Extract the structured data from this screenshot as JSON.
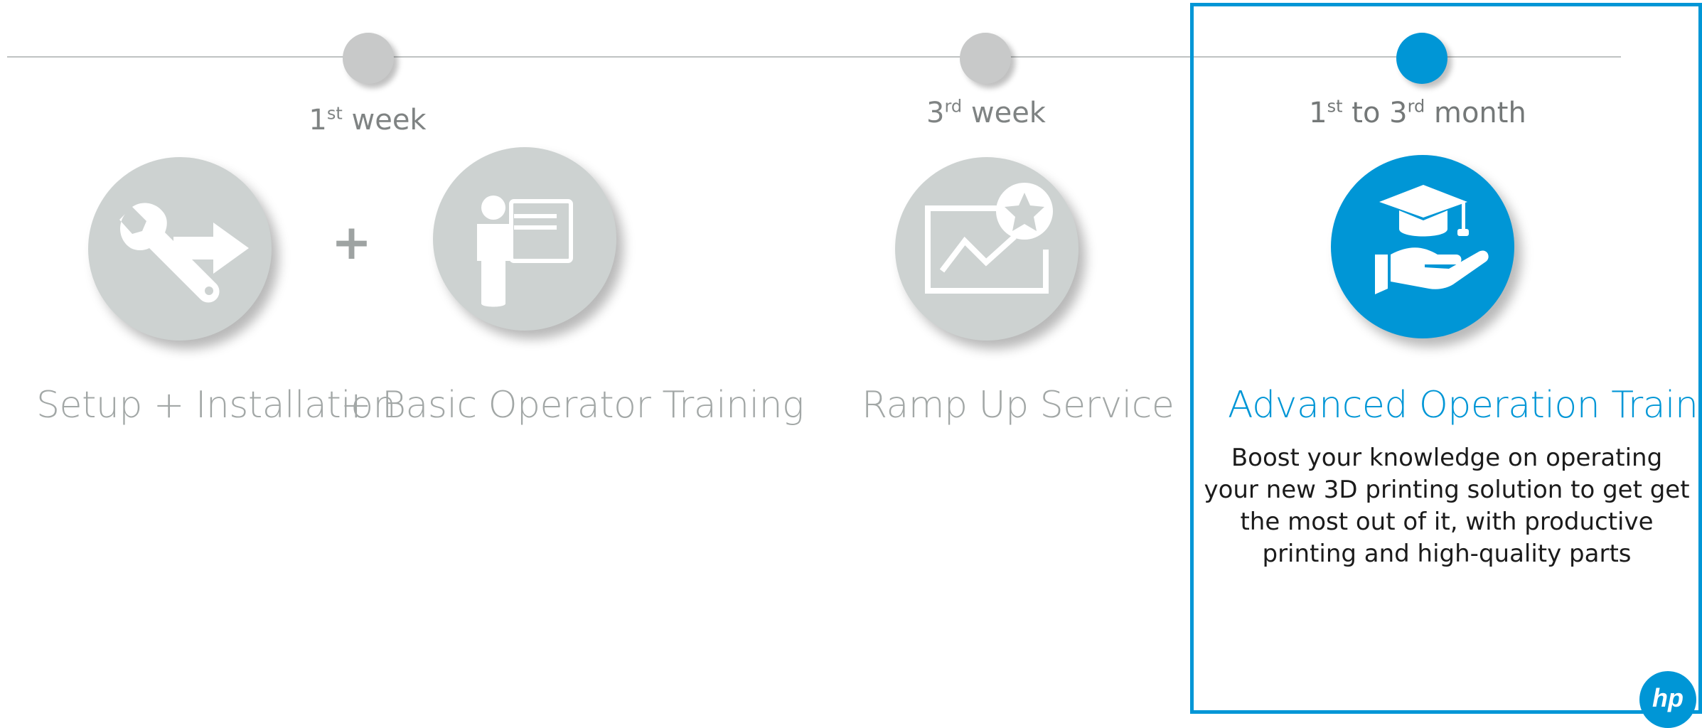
{
  "timeline": {
    "phases": [
      {
        "number": "1",
        "suffix": "st",
        "unit": " week"
      },
      {
        "number": "3",
        "suffix": "rd",
        "unit": " week"
      },
      {
        "number": "1",
        "suffix": "st",
        "mid": " to ",
        "number2": "3",
        "suffix2": "rd",
        "unit": " month"
      }
    ]
  },
  "services": {
    "setup_title": "Setup + Installation",
    "plus": "+",
    "basic_title": "Basic Operator Training",
    "rampup_title": "Ramp Up Service",
    "advanced_title": "Advanced Operation Training",
    "advanced_description": "Boost your knowledge on operating your new 3D printing solution to get get the most out of it, with productive printing and high-quality parts"
  },
  "icons": {
    "setup": "wrench-arrow-icon",
    "basic": "presenter-board-icon",
    "rampup": "chart-star-icon",
    "advanced": "graduation-hand-icon",
    "logo": "hp-logo"
  },
  "colors": {
    "accent": "#0096d6",
    "inactive_circle": "#cdd2d1",
    "inactive_text": "#a2a7a6",
    "body_text": "#1b1b1b"
  }
}
